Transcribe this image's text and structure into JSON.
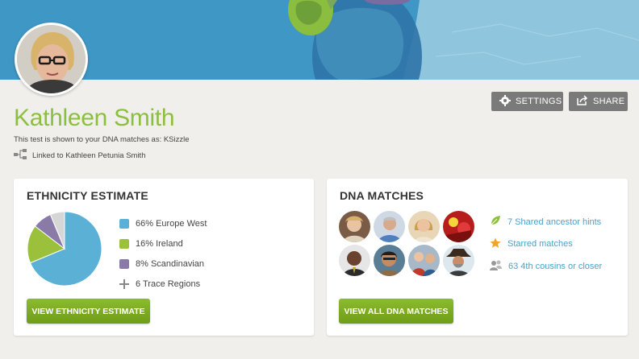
{
  "profile": {
    "name": "Kathleen Smith",
    "note": "This test is shown to your DNA matches as: KSizzle",
    "linked": "Linked to Kathleen Petunia Smith"
  },
  "toolbar": {
    "settings_label": "SETTINGS",
    "share_label": "SHARE"
  },
  "ethnicity": {
    "title": "ETHNICITY ESTIMATE",
    "items": [
      {
        "label": "66% Europe West",
        "color": "#5bb0d6"
      },
      {
        "label": "16% Ireland",
        "color": "#9ac03c"
      },
      {
        "label": "8% Scandinavian",
        "color": "#8a7aa8"
      },
      {
        "label": "6 Trace Regions",
        "color": "#888888"
      }
    ],
    "button_label": "VIEW ETHNICITY ESTIMATE"
  },
  "chart_data": {
    "type": "pie",
    "categories": [
      "Europe West",
      "Ireland",
      "Scandinavian",
      "Trace Regions"
    ],
    "values": [
      66,
      16,
      8,
      6
    ],
    "colors": [
      "#5bb0d6",
      "#9ac03c",
      "#8a7aa8",
      "#d6d6d6"
    ]
  },
  "dna": {
    "title": "DNA MATCHES",
    "links": [
      {
        "label": "7 Shared ancestor hints",
        "icon": "leaf-icon"
      },
      {
        "label": "Starred matches",
        "icon": "star-icon"
      },
      {
        "label": "63 4th cousins or closer",
        "icon": "people-icon"
      }
    ],
    "button_label": "VIEW ALL DNA MATCHES"
  },
  "colors": {
    "accent_green": "#8cbf3f",
    "link_blue": "#4aa3c9",
    "banner_blue": "#3e97c4"
  }
}
